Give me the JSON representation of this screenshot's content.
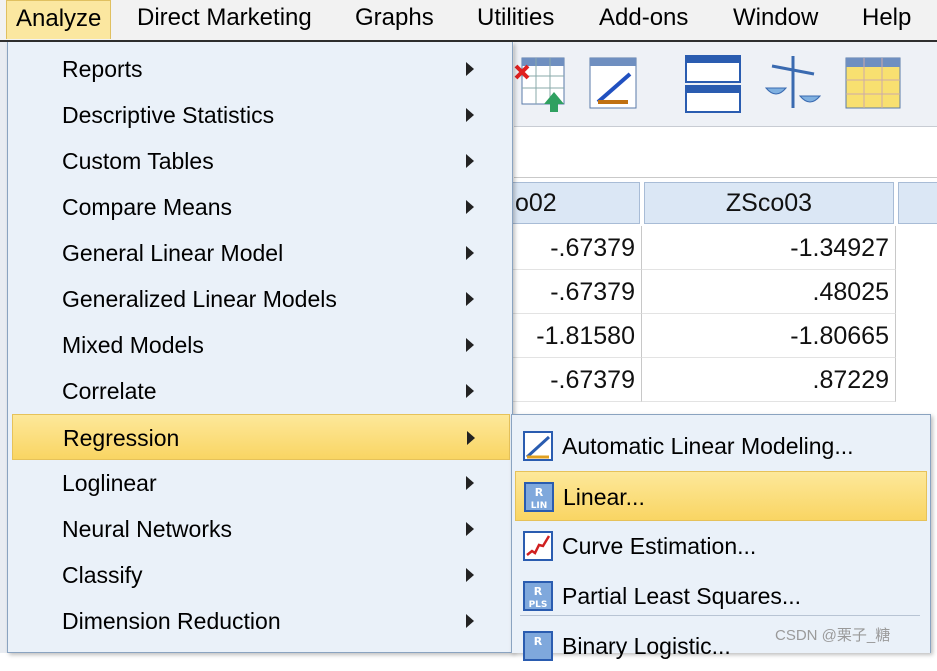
{
  "menubar": {
    "analyze": "Analyze",
    "direct_marketing": "Direct Marketing",
    "graphs": "Graphs",
    "utilities": "Utilities",
    "addons": "Add-ons",
    "window": "Window",
    "help": "Help"
  },
  "grid": {
    "headers": [
      "o02",
      "ZSco03"
    ],
    "rows": [
      [
        "-.67379",
        "-1.34927"
      ],
      [
        "-.67379",
        ".48025"
      ],
      [
        "-1.81580",
        "-1.80665"
      ],
      [
        "-.67379",
        ".87229"
      ]
    ]
  },
  "analyze_menu": {
    "items": [
      {
        "label": "Reports"
      },
      {
        "label": "Descriptive Statistics"
      },
      {
        "label": "Custom Tables"
      },
      {
        "label": "Compare Means"
      },
      {
        "label": "General Linear Model"
      },
      {
        "label": "Generalized Linear Models"
      },
      {
        "label": "Mixed Models"
      },
      {
        "label": "Correlate"
      },
      {
        "label": "Regression"
      },
      {
        "label": "Loglinear"
      },
      {
        "label": "Neural Networks"
      },
      {
        "label": "Classify"
      },
      {
        "label": "Dimension Reduction"
      }
    ],
    "highlighted": "Regression"
  },
  "regression_submenu": {
    "items": [
      {
        "label": "Automatic Linear Modeling...",
        "icon": "auto-linear-icon"
      },
      {
        "label": "Linear...",
        "icon": "linear-regression-icon"
      },
      {
        "label": "Curve Estimation...",
        "icon": "curve-estimation-icon"
      },
      {
        "label": "Partial Least Squares...",
        "icon": "pls-icon"
      },
      {
        "label": "Binary Logistic...",
        "icon": "binary-logistic-icon"
      }
    ],
    "highlighted": "Linear..."
  },
  "watermark": "CSDN @栗子_糖",
  "colors": {
    "menu_bg": "#eaf1f9",
    "highlight": "#f9d563",
    "grid_header": "#dbe7f5"
  }
}
